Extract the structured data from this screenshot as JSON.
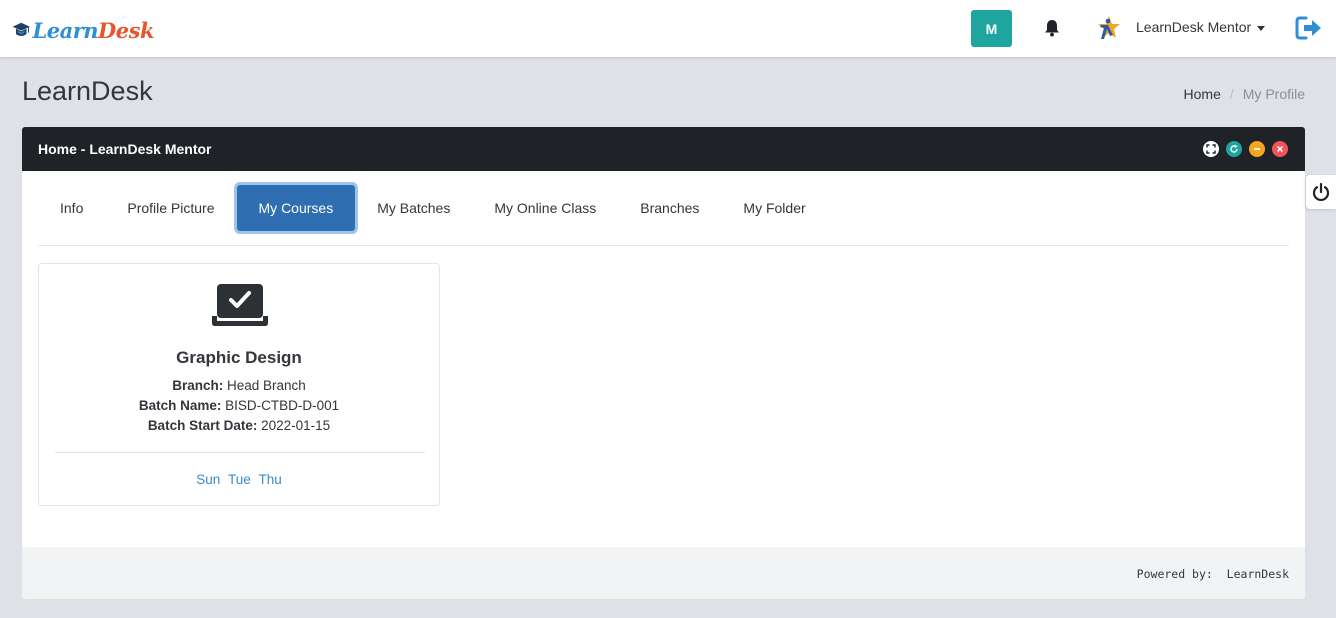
{
  "brand": {
    "logo_part1": "Learn",
    "logo_part2": "Desk"
  },
  "topbar": {
    "avatar_letter": "M",
    "avatar_color": "#1fa5a0",
    "user_name": "LearnDesk Mentor",
    "icons": [
      "bell-icon",
      "star-person-logo",
      "logout-icon"
    ]
  },
  "page": {
    "title": "LearnDesk",
    "breadcrumb": {
      "home": "Home",
      "separator": "/",
      "current": "My Profile"
    }
  },
  "panel": {
    "title": "Home - LearnDesk Mentor",
    "controls": [
      {
        "name": "fullscreen",
        "color": "#ffffff"
      },
      {
        "name": "refresh",
        "color": "#1fa5a0"
      },
      {
        "name": "minimize",
        "color": "#f5a623"
      },
      {
        "name": "close",
        "color": "#f0545a"
      }
    ]
  },
  "tabs": [
    {
      "label": "Info",
      "active": false
    },
    {
      "label": "Profile Picture",
      "active": false
    },
    {
      "label": "My Courses",
      "active": true
    },
    {
      "label": "My Batches",
      "active": false
    },
    {
      "label": "My Online Class",
      "active": false
    },
    {
      "label": "Branches",
      "active": false
    },
    {
      "label": "My Folder",
      "active": false
    }
  ],
  "course_card": {
    "title": "Graphic Design",
    "branch_label": "Branch:",
    "branch": "Head Branch",
    "batch_label": "Batch Name:",
    "batch": "BISD-CTBD-D-001",
    "start_label": "Batch Start Date:",
    "start_date": "2022-01-15",
    "days": [
      "Sun",
      "Tue",
      "Thu"
    ]
  },
  "footer": {
    "powered_by": "Powered by:  LearnDesk"
  },
  "colors": {
    "accent": "#2f6eb0",
    "header_dark": "#1f2226",
    "link": "#3a8cc9"
  }
}
